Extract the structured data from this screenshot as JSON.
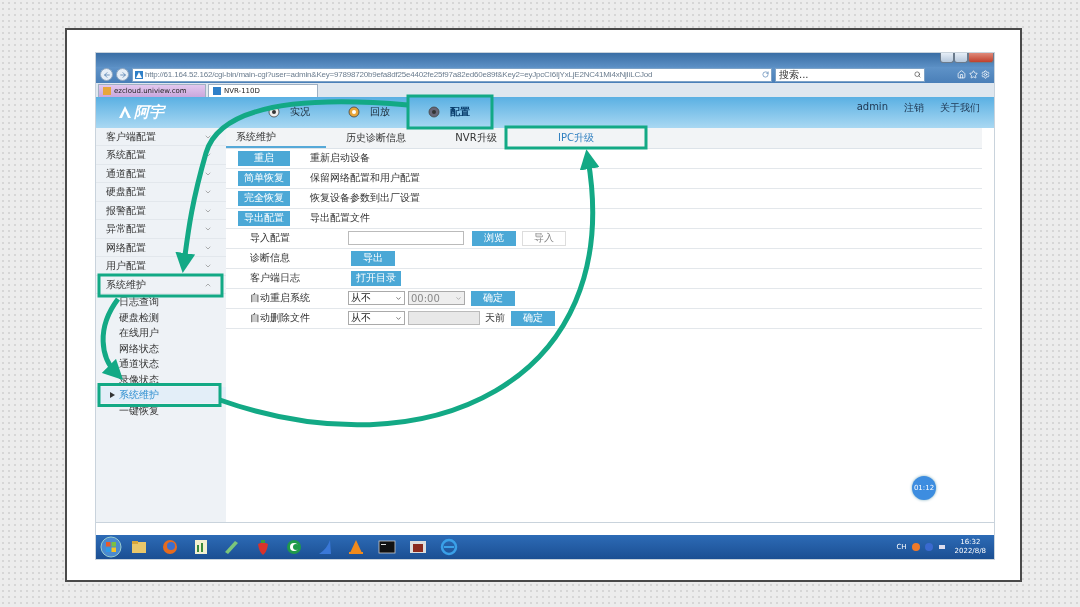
{
  "browser": {
    "url": "http://61.164.52.162/cgi-bin/main-cgi?user=admin&Key=97898720b9efa8df25e4402fe25f97a82ed60e89f&Key2=eyJpcCI6IjYxLjE2NC41Mi4xNjIiLCJod",
    "search_placeholder": "搜索...",
    "tabs": [
      {
        "label": "ezcloud.uniview.com",
        "selected": false
      },
      {
        "label": "NVR-110D",
        "selected": true
      }
    ]
  },
  "header": {
    "logo": "阿宇",
    "nav": [
      {
        "label": "实况",
        "selected": false,
        "highlighted": false
      },
      {
        "label": "回放",
        "selected": false,
        "highlighted": false
      },
      {
        "label": "配置",
        "selected": true,
        "highlighted": true
      }
    ],
    "user_links": [
      "admin",
      "注销",
      "关于我们"
    ]
  },
  "sidebar": {
    "items": [
      {
        "label": "客户端配置",
        "expanded": false,
        "highlighted": false
      },
      {
        "label": "系统配置",
        "expanded": false,
        "highlighted": false
      },
      {
        "label": "通道配置",
        "expanded": false,
        "highlighted": false
      },
      {
        "label": "硬盘配置",
        "expanded": false,
        "highlighted": false
      },
      {
        "label": "报警配置",
        "expanded": false,
        "highlighted": false
      },
      {
        "label": "异常配置",
        "expanded": false,
        "highlighted": false
      },
      {
        "label": "网络配置",
        "expanded": false,
        "highlighted": false
      },
      {
        "label": "用户配置",
        "expanded": false,
        "highlighted": false
      },
      {
        "label": "系统维护",
        "expanded": true,
        "highlighted": true,
        "children": [
          {
            "label": "日志查询",
            "selected": false,
            "highlighted": false
          },
          {
            "label": "硬盘检测",
            "selected": false,
            "highlighted": false
          },
          {
            "label": "在线用户",
            "selected": false,
            "highlighted": false
          },
          {
            "label": "网络状态",
            "selected": false,
            "highlighted": false
          },
          {
            "label": "通道状态",
            "selected": false,
            "highlighted": false
          },
          {
            "label": "录像状态",
            "selected": false,
            "highlighted": false
          },
          {
            "label": "系统维护",
            "selected": true,
            "highlighted": true
          },
          {
            "label": "一键恢复",
            "selected": false,
            "highlighted": false
          }
        ]
      }
    ]
  },
  "tabs": [
    {
      "label": "系统维护",
      "selected": true,
      "highlighted": false
    },
    {
      "label": "历史诊断信息",
      "selected": false,
      "highlighted": false
    },
    {
      "label": "NVR升级",
      "selected": false,
      "highlighted": false
    },
    {
      "label": "IPC升级",
      "selected": false,
      "highlighted": true
    }
  ],
  "actions": [
    {
      "button": "重启",
      "description": "重新启动设备"
    },
    {
      "button": "简单恢复",
      "description": "保留网络配置和用户配置"
    },
    {
      "button": "完全恢复",
      "description": "恢复设备参数到出厂设置"
    },
    {
      "button": "导出配置",
      "description": "导出配置文件"
    }
  ],
  "settings": [
    {
      "label": "导入配置",
      "controls": [
        {
          "kind": "input",
          "disabled": false
        },
        {
          "kind": "button",
          "label": "浏览",
          "disabled": false
        },
        {
          "kind": "button",
          "label": "导入",
          "disabled": true
        }
      ]
    },
    {
      "label": "诊断信息",
      "controls": [
        {
          "kind": "button",
          "label": "导出",
          "disabled": false
        }
      ]
    },
    {
      "label": "客户端日志",
      "controls": [
        {
          "kind": "button",
          "label": "打开目录",
          "disabled": false
        }
      ]
    },
    {
      "label": "自动重启系统",
      "controls": [
        {
          "kind": "select",
          "value": "从不",
          "disabled": false
        },
        {
          "kind": "select",
          "value": "00:00",
          "disabled": true
        },
        {
          "kind": "button",
          "label": "确定",
          "disabled": false
        }
      ]
    },
    {
      "label": "自动删除文件",
      "controls": [
        {
          "kind": "select",
          "value": "从不",
          "disabled": false
        },
        {
          "kind": "input",
          "disabled": true
        },
        {
          "kind": "text",
          "label": "天前"
        },
        {
          "kind": "button",
          "label": "确定",
          "disabled": false
        }
      ]
    }
  ],
  "timer": "01:12",
  "taskbar": {
    "language": "CH",
    "time": "16:32",
    "date": "2022/8/8"
  }
}
